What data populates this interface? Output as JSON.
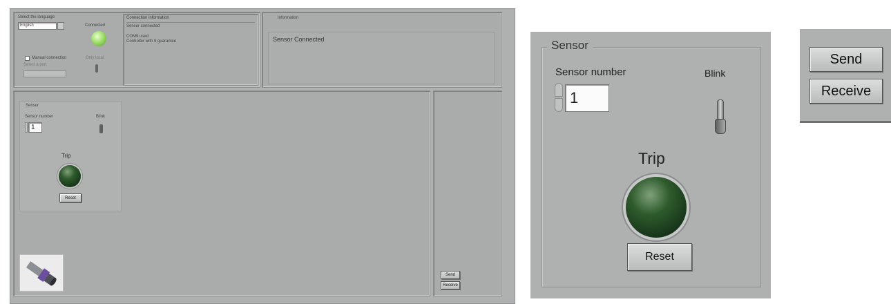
{
  "front_panel": {
    "select_language_label": "Select the language",
    "language_value": "English",
    "connected_label": "Connected",
    "manual_connection_label": "Manual connection",
    "manual_connection_hint": "Only local",
    "port_label": "Select a port",
    "connection_info_title": "Connection information",
    "connection_info_lines": [
      "Sensor connected",
      "COM9 used",
      "Controller with 9 guarantee"
    ],
    "information_title": "Information",
    "information_text": "Sensor Connected",
    "sensor_title": "Sensor",
    "sensor_number_label": "Sensor number",
    "sensor_number_value": "1",
    "blink_label": "Blink",
    "trip_label": "Trip",
    "reset_label": "Reset",
    "send_label": "Send",
    "receive_label": "Receive"
  },
  "sensor_zoom": {
    "title": "Sensor",
    "sensor_number_label": "Sensor number",
    "sensor_number_value": "1",
    "blink_label": "Blink",
    "trip_label": "Trip",
    "reset_label": "Reset"
  },
  "buttons_zoom": {
    "send_label": "Send",
    "receive_label": "Receive"
  },
  "colors": {
    "panel": "#aeb1b0",
    "led_off": "#1f3d1f",
    "led_on": "#9fe06a"
  }
}
